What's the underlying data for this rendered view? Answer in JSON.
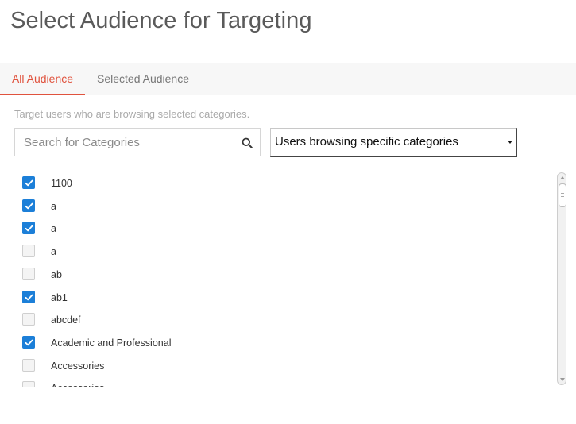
{
  "page": {
    "title": "Select Audience for Targeting"
  },
  "tabs": [
    {
      "label": "All Audience",
      "active": true
    },
    {
      "label": "Selected Audience",
      "active": false
    }
  ],
  "hint": "Target users who are browsing selected categories.",
  "search": {
    "placeholder": "Search for Categories",
    "value": "",
    "icon": "search-icon"
  },
  "audience_select": {
    "value": "Users browsing specific categories"
  },
  "categories": [
    {
      "label": "1100",
      "checked": true
    },
    {
      "label": "a",
      "checked": true
    },
    {
      "label": "a",
      "checked": true
    },
    {
      "label": "a",
      "checked": false
    },
    {
      "label": "ab",
      "checked": false
    },
    {
      "label": "ab1",
      "checked": true
    },
    {
      "label": "abcdef",
      "checked": false
    },
    {
      "label": "Academic and Professional",
      "checked": true
    },
    {
      "label": "Accessories",
      "checked": false
    },
    {
      "label": "Accessories",
      "checked": false
    }
  ],
  "colors": {
    "accent": "#e0533e",
    "checkbox_checked": "#1c7fd8"
  }
}
